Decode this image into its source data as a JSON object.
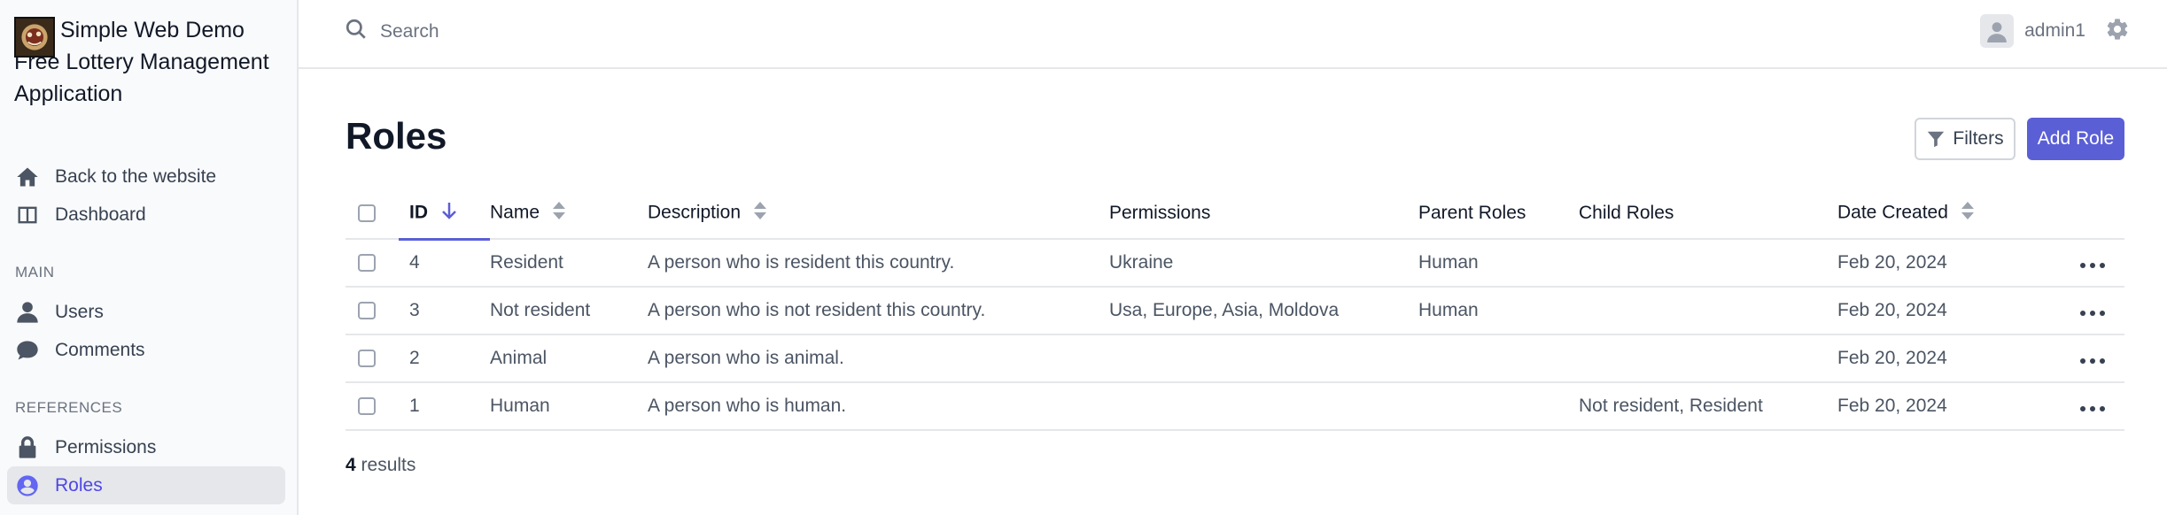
{
  "brand": {
    "title_line1": "Simple Web Demo",
    "title_rest": "Free Lottery Management Application"
  },
  "sidebar": {
    "top_items": [
      {
        "label": "Back to the website",
        "icon": "home-icon"
      },
      {
        "label": "Dashboard",
        "icon": "dashboard-icon"
      }
    ],
    "sections": [
      {
        "title": "MAIN",
        "items": [
          {
            "label": "Users",
            "icon": "user-icon"
          },
          {
            "label": "Comments",
            "icon": "comment-icon"
          }
        ]
      },
      {
        "title": "REFERENCES",
        "items": [
          {
            "label": "Permissions",
            "icon": "lock-icon"
          },
          {
            "label": "Roles",
            "icon": "user-circle-icon",
            "active": true
          }
        ]
      }
    ]
  },
  "topbar": {
    "search_placeholder": "Search",
    "username": "admin1"
  },
  "page": {
    "title": "Roles",
    "filters_label": "Filters",
    "add_label": "Add Role"
  },
  "table": {
    "columns": [
      "ID",
      "Name",
      "Description",
      "Permissions",
      "Parent Roles",
      "Child Roles",
      "Date Created"
    ],
    "rows": [
      {
        "id": "4",
        "name": "Resident",
        "description": "A person who is resident this country.",
        "permissions": "Ukraine",
        "parent": "Human",
        "child": "",
        "date": "Feb 20, 2024"
      },
      {
        "id": "3",
        "name": "Not resident",
        "description": "A person who is not resident this country.",
        "permissions": "Usa, Europe, Asia, Moldova",
        "parent": "Human",
        "child": "",
        "date": "Feb 20, 2024"
      },
      {
        "id": "2",
        "name": "Animal",
        "description": "A person who is animal.",
        "permissions": "",
        "parent": "",
        "child": "",
        "date": "Feb 20, 2024"
      },
      {
        "id": "1",
        "name": "Human",
        "description": "A person who is human.",
        "permissions": "",
        "parent": "",
        "child": "Not resident, Resident",
        "date": "Feb 20, 2024"
      }
    ]
  },
  "results": {
    "count": "4",
    "label": "results"
  },
  "colors": {
    "accent": "#5b5fd6",
    "sidebar_bg": "#f9fafb",
    "active_bg": "#e5e7eb"
  }
}
